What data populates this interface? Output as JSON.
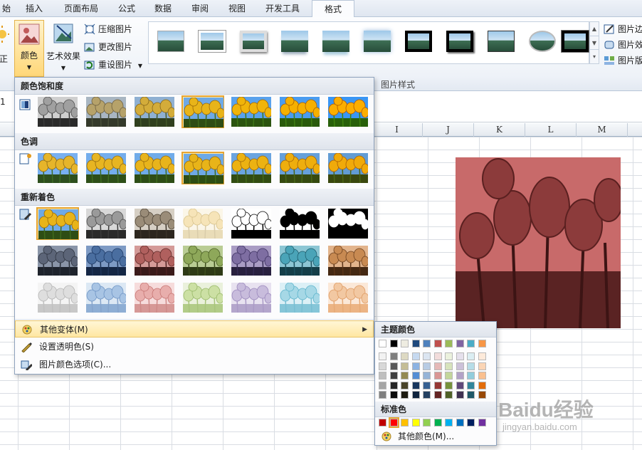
{
  "tabs": [
    "始",
    "插入",
    "页面布局",
    "公式",
    "数据",
    "审阅",
    "视图",
    "开发工具",
    "格式"
  ],
  "active_tab_index": 8,
  "ribbon": {
    "correct_label": "正",
    "color_label": "颜色",
    "artistic_label": "艺术效果",
    "compress_label": "压缩图片",
    "change_label": "更改图片",
    "reset_label": "重设图片",
    "border_label": "图片边",
    "effects_label": "图片效",
    "layout_label": "图片版",
    "styles_group_label": "图片样式"
  },
  "formula_bar": {
    "cell_ref": "1"
  },
  "columns": [
    "I",
    "J",
    "K",
    "L",
    "M"
  ],
  "dropdown": {
    "saturation_header": "颜色饱和度",
    "tone_header": "色调",
    "recolor_header": "重新着色",
    "more_variations": "其他变体(M)",
    "set_transparent": "设置透明色(S)",
    "color_options": "图片颜色选项(C)..."
  },
  "submenu": {
    "theme_colors_header": "主题颜色",
    "standard_colors_header": "标准色",
    "more_colors": "其他颜色(M)...",
    "theme_top_row": [
      "#ffffff",
      "#000000",
      "#eeece1",
      "#1f497d",
      "#4f81bd",
      "#c0504d",
      "#9bbb59",
      "#8064a2",
      "#4bacc6",
      "#f79646"
    ],
    "theme_shades": [
      [
        "#f2f2f2",
        "#d8d8d8",
        "#bfbfbf",
        "#a5a5a5",
        "#7f7f7f"
      ],
      [
        "#7f7f7f",
        "#595959",
        "#3f3f3f",
        "#262626",
        "#0c0c0c"
      ],
      [
        "#ddd9c3",
        "#c4bd97",
        "#938953",
        "#494429",
        "#1d1b10"
      ],
      [
        "#c6d9f0",
        "#8db3e2",
        "#548dd4",
        "#17365d",
        "#0f243e"
      ],
      [
        "#dbe5f1",
        "#b8cce4",
        "#95b3d7",
        "#366092",
        "#244061"
      ],
      [
        "#f2dcdb",
        "#e5b9b7",
        "#d99694",
        "#953734",
        "#632423"
      ],
      [
        "#ebf1dd",
        "#d7e3bc",
        "#c3d69b",
        "#76923c",
        "#4f6128"
      ],
      [
        "#e5e0ec",
        "#ccc1d9",
        "#b2a2c7",
        "#5f497a",
        "#3f3151"
      ],
      [
        "#dbeef3",
        "#b7dde8",
        "#92cddc",
        "#31859b",
        "#205867"
      ],
      [
        "#fdeada",
        "#fbd5b5",
        "#fac08f",
        "#e36c09",
        "#974806"
      ]
    ],
    "standard": [
      "#c00000",
      "#ff0000",
      "#ffc000",
      "#ffff00",
      "#92d050",
      "#00b050",
      "#00b0f0",
      "#0070c0",
      "#002060",
      "#7030a0"
    ],
    "selected_standard_index": 1
  },
  "watermark": {
    "line1": "Baidu经验",
    "line2": "jingyan.baidu.com"
  },
  "colors": {
    "accent_highlight": "#e6a431",
    "recolor_target": "#c86a6a"
  }
}
